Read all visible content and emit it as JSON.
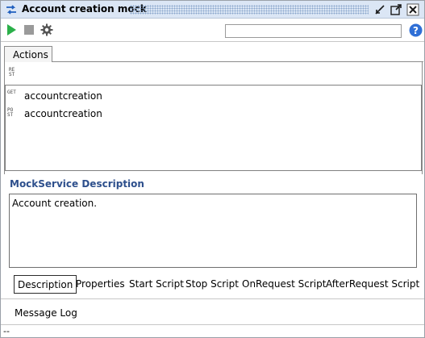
{
  "window": {
    "title": "Account creation mock"
  },
  "titlebar": {
    "icons": [
      "mock-service-icon",
      "restore-icon",
      "maximize-icon",
      "close-icon"
    ]
  },
  "toolbar": {
    "icons": [
      "play-icon",
      "stop-icon",
      "gear-icon"
    ],
    "search": {
      "value": "",
      "placeholder": ""
    },
    "help_icon": "help-icon"
  },
  "tabs": [
    {
      "label": "Actions",
      "active": true
    }
  ],
  "actions_panel": {
    "header_badge": [
      "RE",
      "ST"
    ],
    "items": [
      {
        "method": [
          "GET"
        ],
        "name": "accountcreation"
      },
      {
        "method": [
          "PO",
          "ST"
        ],
        "name": "accountcreation"
      }
    ]
  },
  "description": {
    "title": "MockService Description",
    "text": "Account creation."
  },
  "bottom_tabs": [
    {
      "label": "Description",
      "active": true
    },
    {
      "label": "Properties",
      "active": false
    },
    {
      "label": "Start Script",
      "active": false
    },
    {
      "label": "Stop Script",
      "active": false
    },
    {
      "label": "OnRequest Script",
      "active": false
    },
    {
      "label": "AfterRequest Script",
      "active": false
    }
  ],
  "message_log": {
    "label": "Message Log"
  },
  "status_bar": {
    "text": "--"
  },
  "colors": {
    "title_bg": "#dbe6f5",
    "accent_blue": "#2d4f8c",
    "play_green": "#2bb04a",
    "help_blue": "#2f6fd6"
  }
}
